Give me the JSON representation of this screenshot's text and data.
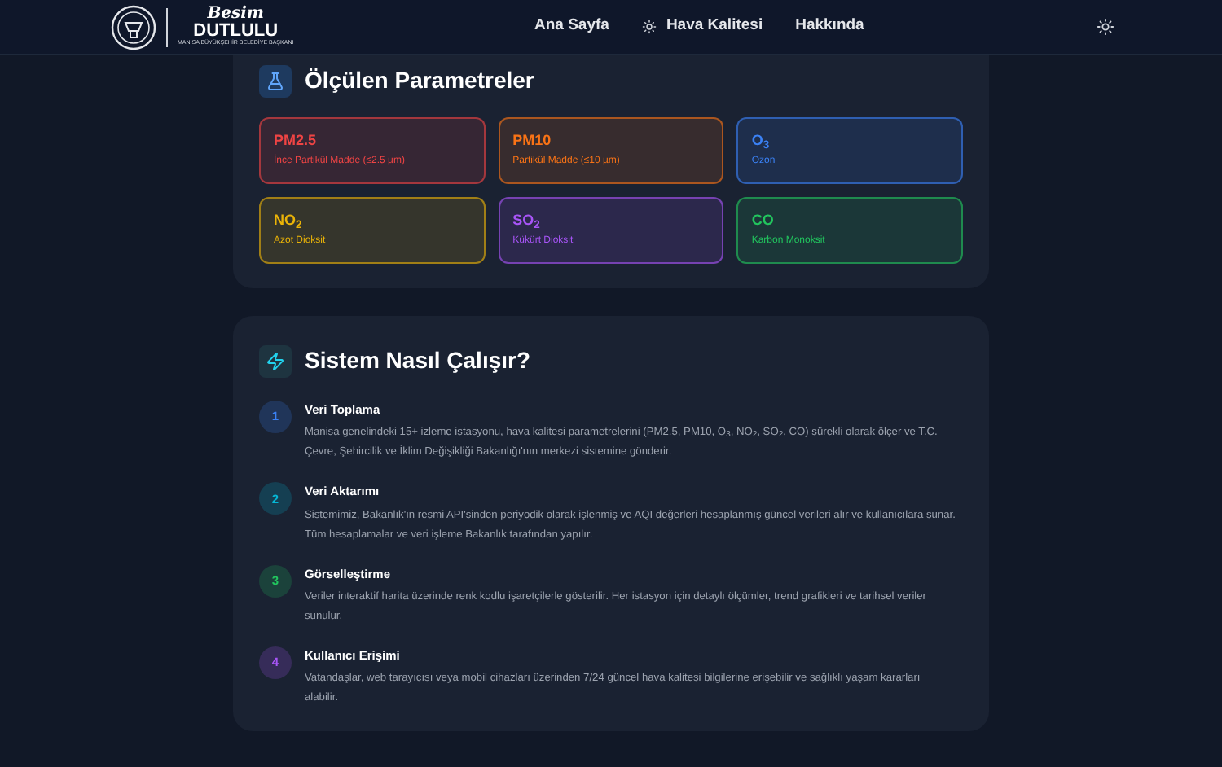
{
  "nav": {
    "logo": {
      "script": "Besim",
      "name": "DUTLULU",
      "subtitle": "MANİSA BÜYÜKŞEHİR BELEDİYE BAŞKANI"
    },
    "links": [
      {
        "label": "Ana Sayfa",
        "icon": false
      },
      {
        "label": "Hava Kalitesi",
        "icon": true
      },
      {
        "label": "Hakkında",
        "icon": false
      }
    ]
  },
  "parameters": {
    "title": "Ölçülen Parametreler",
    "items": [
      {
        "code": "PM2.5",
        "desc": "İnce Partikül Madde (≤2.5 µm)",
        "color": "#ef4444"
      },
      {
        "code": "PM10",
        "desc": "Partikül Madde (≤10 µm)",
        "color": "#f97316"
      },
      {
        "code": "O$_{3}$",
        "desc": "Ozon",
        "color": "#3b82f6"
      },
      {
        "code": "NO$_{2}$",
        "desc": "Azot Dioksit",
        "color": "#eab308"
      },
      {
        "code": "SO$_{2}$",
        "desc": "Kükürt Dioksit",
        "color": "#a855f7"
      },
      {
        "code": "CO",
        "desc": "Karbon Monoksit",
        "color": "#22c55e"
      }
    ]
  },
  "how": {
    "title": "Sistem Nasıl Çalışır?",
    "steps": [
      {
        "number": "1",
        "title": "Veri Toplama",
        "text": "Manisa genelindeki 15+ izleme istasyonu, hava kalitesi parametrelerini (PM2.5, PM10, O$_{3}$, NO$_{2}$, SO$_{2}$, CO) sürekli olarak ölçer ve T.C. Çevre, Şehircilik ve İklim Değişikliği Bakanlığı'nın merkezi sistemine gönderir.",
        "color": "#3b82f6"
      },
      {
        "number": "2",
        "title": "Veri Aktarımı",
        "text": "Sistemimiz, Bakanlık'ın resmi API'sinden periyodik olarak işlenmiş ve AQI değerleri hesaplanmış güncel verileri alır ve kullanıcılara sunar. Tüm hesaplamalar ve veri işleme Bakanlık tarafından yapılır.",
        "color": "#06b6d4"
      },
      {
        "number": "3",
        "title": "Görselleştirme",
        "text": "Veriler interaktif harita üzerinde renk kodlu işaretçilerle gösterilir. Her istasyon için detaylı ölçümler, trend grafikleri ve tarihsel veriler sunulur.",
        "color": "#22c55e"
      },
      {
        "number": "4",
        "title": "Kullanıcı Erişimi",
        "text": "Vatandaşlar, web tarayıcısı veya mobil cihazları üzerinden 7/24 güncel hava kalitesi bilgilerine erişebilir ve sağlıklı yaşam kararları alabilir.",
        "color": "#a855f7"
      }
    ]
  }
}
